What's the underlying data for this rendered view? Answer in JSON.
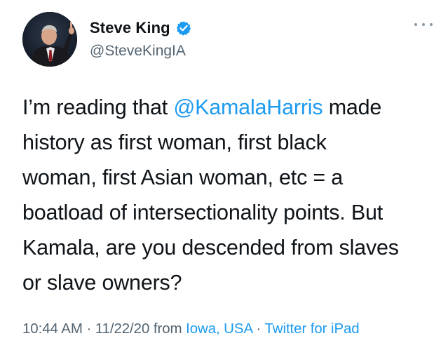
{
  "author": {
    "display_name": "Steve King",
    "handle": "@SteveKingIA",
    "verified": true
  },
  "tweet": {
    "lines": [
      {
        "pre": "I’m reading that ",
        "mention": "@KamalaHarris",
        "post": " made"
      },
      {
        "text": "history as first woman, first black"
      },
      {
        "text": "woman, first Asian woman, etc = a"
      },
      {
        "text": "boatload of intersectionality points. But"
      },
      {
        "text": "Kamala, are you descended from slaves"
      },
      {
        "text": "or slave owners?"
      }
    ]
  },
  "meta": {
    "time": "10:44 AM",
    "separator": "·",
    "date": "11/22/20",
    "from_label": "from",
    "location": "Iowa, USA",
    "client": "Twitter for iPad"
  },
  "colors": {
    "link": "#1d9bf0",
    "text": "#0f1419",
    "secondary": "#536471"
  },
  "icons": {
    "verified": "verified-badge-icon",
    "more": "more-options-icon"
  }
}
